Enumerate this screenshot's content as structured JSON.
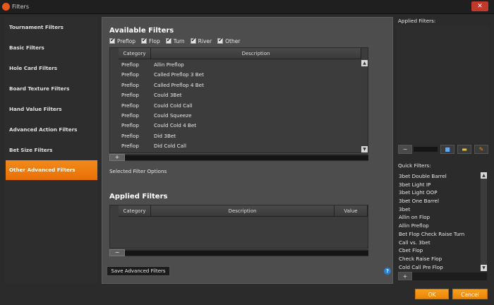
{
  "window": {
    "title": "Filters",
    "close_glyph": "✕"
  },
  "sidebar": {
    "items": [
      {
        "label": "Tournament Filters"
      },
      {
        "label": "Basic Filters"
      },
      {
        "label": "Hole Card Filters"
      },
      {
        "label": "Board Texture Filters"
      },
      {
        "label": "Hand Value Filters"
      },
      {
        "label": "Advanced Action Filters"
      },
      {
        "label": "Bet Size Filters"
      },
      {
        "label": "Other Advanced Filters",
        "active": true
      }
    ]
  },
  "available": {
    "title": "Available Filters",
    "checkboxes": [
      "Preflop",
      "Flop",
      "Turn",
      "River",
      "Other"
    ],
    "columns": [
      "Category",
      "Description"
    ],
    "rows": [
      {
        "category": "Preflop",
        "description": "Allin Preflop"
      },
      {
        "category": "Preflop",
        "description": "Called Preflop 3 Bet"
      },
      {
        "category": "Preflop",
        "description": "Called Preflop 4 Bet"
      },
      {
        "category": "Preflop",
        "description": "Could 3Bet"
      },
      {
        "category": "Preflop",
        "description": "Could Cold Call"
      },
      {
        "category": "Preflop",
        "description": "Could Squeeze"
      },
      {
        "category": "Preflop",
        "description": "Could Cold 4 Bet"
      },
      {
        "category": "Preflop",
        "description": "Did 3Bet"
      },
      {
        "category": "Preflop",
        "description": "Did Cold Call"
      }
    ],
    "add_glyph": "+"
  },
  "selected_filter_options_label": "Selected Filter Options",
  "applied": {
    "title": "Applied Filters",
    "columns": [
      "Category",
      "Description",
      "Value"
    ],
    "remove_glyph": "−"
  },
  "save_button_label": "Save Advanced Filters",
  "help_glyph": "?",
  "right_panel": {
    "applied_label": "Applied Filters:",
    "quick_label": "Quick Filters:",
    "quick_items": [
      "3bet Double Barrel",
      "3bet Light IP",
      "3bet Light OOP",
      "3bet One Barrel",
      "3bet",
      "Allin on Flop",
      "Allin Preflop",
      "Bet Flop Check Raise Turn",
      "Call vs. 3bet",
      "Cbet Flop",
      "Check Raise Flop",
      "Cold Call Pre Flop"
    ],
    "minus_glyph": "−",
    "plus_glyph": "+"
  },
  "footer": {
    "ok_label": "OK",
    "cancel_label": "Cancel"
  },
  "colors": {
    "accent": "#f08a12",
    "background": "#2b2b2b",
    "panel": "#4d4d4d"
  }
}
